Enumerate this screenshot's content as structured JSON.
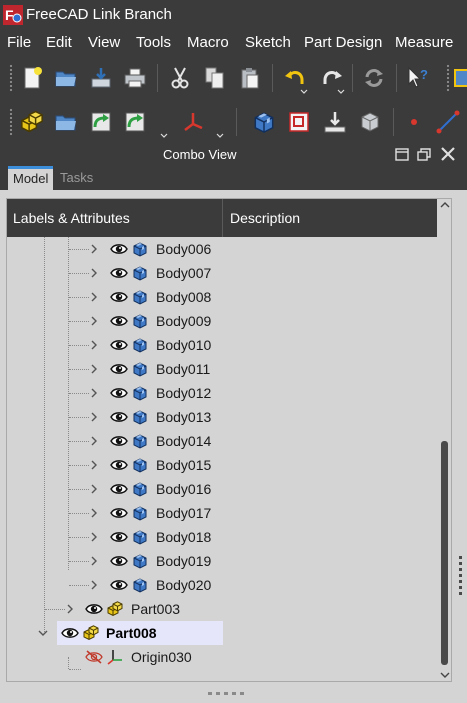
{
  "window": {
    "title": "FreeCAD Link Branch",
    "app_icon": "freecad-logo-icon",
    "titlebar_color": "#3b3b3b"
  },
  "menubar": {
    "items": [
      {
        "label": "File"
      },
      {
        "label": "Edit"
      },
      {
        "label": "View"
      },
      {
        "label": "Tools"
      },
      {
        "label": "Macro"
      },
      {
        "label": "Sketch"
      },
      {
        "label": "Part Design"
      },
      {
        "label": "Measure"
      }
    ]
  },
  "toolbar_file": {
    "buttons": [
      "new-document-icon",
      "open-folder-icon",
      "save-icon",
      "print-icon",
      "cut-icon",
      "copy-icon",
      "paste-icon",
      "undo-icon",
      "redo-icon",
      "refresh-icon",
      "whats-this-icon"
    ]
  },
  "toolbar_structure": {
    "buttons": [
      "create-part-icon",
      "create-group-icon",
      "link-icon",
      "link-actions-icon",
      "place-axis-icon",
      "create-body-icon",
      "create-sketch-icon",
      "validate-sketch-icon",
      "subshape-binder-icon",
      "point-icon",
      "line-icon"
    ]
  },
  "combo_view": {
    "title": "Combo View",
    "tabs": [
      {
        "label": "Model",
        "active": true
      },
      {
        "label": "Tasks",
        "active": false
      }
    ]
  },
  "tree": {
    "columns": {
      "labels": "Labels & Attributes",
      "description": "Description"
    },
    "bodies": [
      {
        "label": "Body006"
      },
      {
        "label": "Body007"
      },
      {
        "label": "Body008"
      },
      {
        "label": "Body009"
      },
      {
        "label": "Body010"
      },
      {
        "label": "Body011"
      },
      {
        "label": "Body012"
      },
      {
        "label": "Body013"
      },
      {
        "label": "Body014"
      },
      {
        "label": "Body015"
      },
      {
        "label": "Body016"
      },
      {
        "label": "Body017"
      },
      {
        "label": "Body018"
      },
      {
        "label": "Body019"
      },
      {
        "label": "Body020"
      }
    ],
    "part_collapsed": {
      "label": "Part003"
    },
    "part_selected": {
      "label": "Part008",
      "selected": true
    },
    "origin": {
      "label": "Origin030",
      "hidden": true
    }
  },
  "colors": {
    "accent_tab": "#3c8edb",
    "body_blue": "#3f78c4",
    "part_yellow": "#e8c619",
    "selection": "#e6e6fa"
  }
}
